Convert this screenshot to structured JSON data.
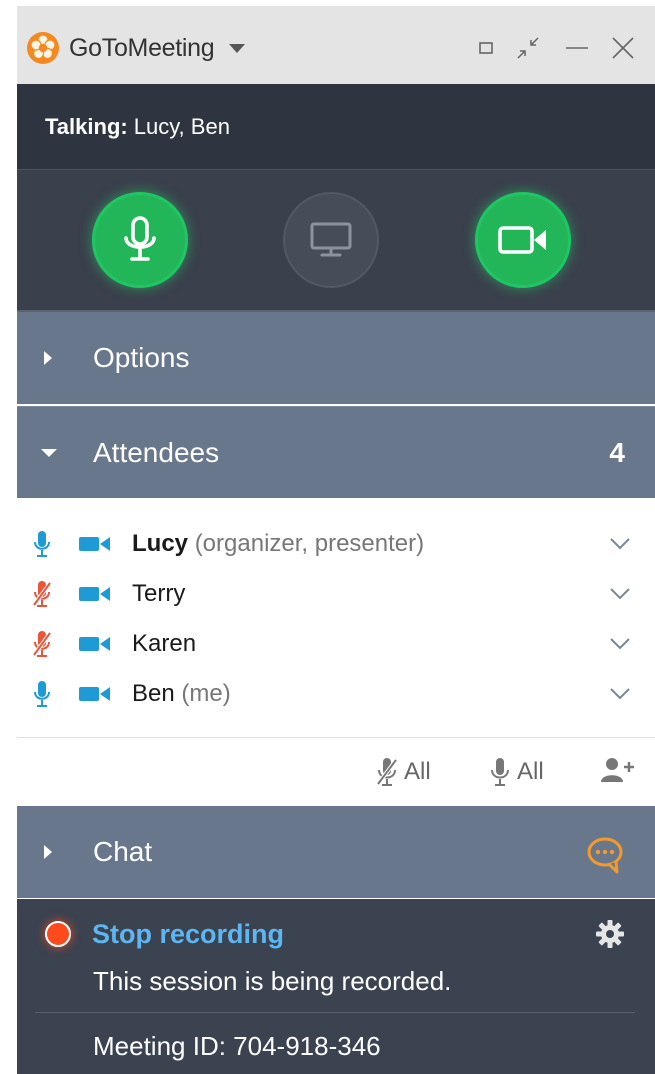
{
  "titlebar": {
    "app_title": "GoToMeeting",
    "logo_icon": "gotomeeting-flower-logo",
    "controls": [
      "restore",
      "compact",
      "minimize",
      "close"
    ]
  },
  "talking": {
    "label": "Talking:",
    "names": "Lucy, Ben"
  },
  "media_controls": {
    "microphone": "on",
    "screen_share": "off",
    "webcam": "on"
  },
  "options": {
    "label": "Options"
  },
  "attendees": {
    "label": "Attendees",
    "count": "4",
    "rows": [
      {
        "name": "Lucy",
        "role": "(organizer, presenter)",
        "mic": "unmuted",
        "camera": "on"
      },
      {
        "name": "Terry",
        "role": "",
        "mic": "muted",
        "camera": "on"
      },
      {
        "name": "Karen",
        "role": "",
        "mic": "muted",
        "camera": "on"
      },
      {
        "name": "Ben",
        "role": "(me)",
        "mic": "unmuted",
        "camera": "on"
      }
    ],
    "mute_all_label": "All",
    "unmute_all_label": "All"
  },
  "chat": {
    "label": "Chat"
  },
  "recording": {
    "stop_label": "Stop recording",
    "status": "This session is being recorded.",
    "meeting_id": "Meeting ID: 704-918-346"
  },
  "colors": {
    "accent_green": "#22b659",
    "mic_blue": "#1e9ad6",
    "muted_red": "#e8553b",
    "chat_orange": "#f59a2a",
    "link_blue": "#5cb6f2",
    "header_slate": "#69778d",
    "dark_panel": "#3a414c"
  }
}
